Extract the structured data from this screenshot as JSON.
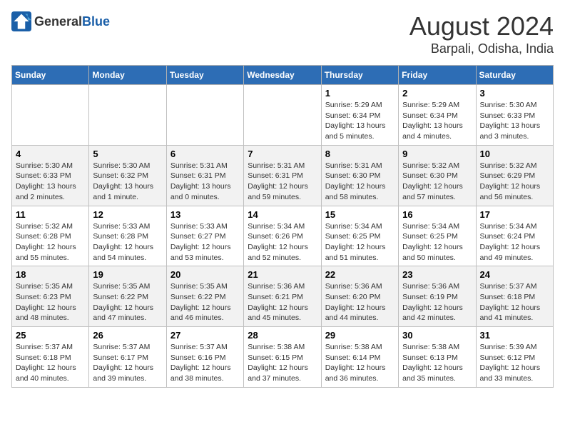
{
  "logo": {
    "general": "General",
    "blue": "Blue"
  },
  "title": "August 2024",
  "subtitle": "Barpali, Odisha, India",
  "headers": [
    "Sunday",
    "Monday",
    "Tuesday",
    "Wednesday",
    "Thursday",
    "Friday",
    "Saturday"
  ],
  "weeks": [
    [
      {
        "day": "",
        "info": ""
      },
      {
        "day": "",
        "info": ""
      },
      {
        "day": "",
        "info": ""
      },
      {
        "day": "",
        "info": ""
      },
      {
        "day": "1",
        "info": "Sunrise: 5:29 AM\nSunset: 6:34 PM\nDaylight: 13 hours\nand 5 minutes."
      },
      {
        "day": "2",
        "info": "Sunrise: 5:29 AM\nSunset: 6:34 PM\nDaylight: 13 hours\nand 4 minutes."
      },
      {
        "day": "3",
        "info": "Sunrise: 5:30 AM\nSunset: 6:33 PM\nDaylight: 13 hours\nand 3 minutes."
      }
    ],
    [
      {
        "day": "4",
        "info": "Sunrise: 5:30 AM\nSunset: 6:33 PM\nDaylight: 13 hours\nand 2 minutes."
      },
      {
        "day": "5",
        "info": "Sunrise: 5:30 AM\nSunset: 6:32 PM\nDaylight: 13 hours\nand 1 minute."
      },
      {
        "day": "6",
        "info": "Sunrise: 5:31 AM\nSunset: 6:31 PM\nDaylight: 13 hours\nand 0 minutes."
      },
      {
        "day": "7",
        "info": "Sunrise: 5:31 AM\nSunset: 6:31 PM\nDaylight: 12 hours\nand 59 minutes."
      },
      {
        "day": "8",
        "info": "Sunrise: 5:31 AM\nSunset: 6:30 PM\nDaylight: 12 hours\nand 58 minutes."
      },
      {
        "day": "9",
        "info": "Sunrise: 5:32 AM\nSunset: 6:30 PM\nDaylight: 12 hours\nand 57 minutes."
      },
      {
        "day": "10",
        "info": "Sunrise: 5:32 AM\nSunset: 6:29 PM\nDaylight: 12 hours\nand 56 minutes."
      }
    ],
    [
      {
        "day": "11",
        "info": "Sunrise: 5:32 AM\nSunset: 6:28 PM\nDaylight: 12 hours\nand 55 minutes."
      },
      {
        "day": "12",
        "info": "Sunrise: 5:33 AM\nSunset: 6:28 PM\nDaylight: 12 hours\nand 54 minutes."
      },
      {
        "day": "13",
        "info": "Sunrise: 5:33 AM\nSunset: 6:27 PM\nDaylight: 12 hours\nand 53 minutes."
      },
      {
        "day": "14",
        "info": "Sunrise: 5:34 AM\nSunset: 6:26 PM\nDaylight: 12 hours\nand 52 minutes."
      },
      {
        "day": "15",
        "info": "Sunrise: 5:34 AM\nSunset: 6:25 PM\nDaylight: 12 hours\nand 51 minutes."
      },
      {
        "day": "16",
        "info": "Sunrise: 5:34 AM\nSunset: 6:25 PM\nDaylight: 12 hours\nand 50 minutes."
      },
      {
        "day": "17",
        "info": "Sunrise: 5:34 AM\nSunset: 6:24 PM\nDaylight: 12 hours\nand 49 minutes."
      }
    ],
    [
      {
        "day": "18",
        "info": "Sunrise: 5:35 AM\nSunset: 6:23 PM\nDaylight: 12 hours\nand 48 minutes."
      },
      {
        "day": "19",
        "info": "Sunrise: 5:35 AM\nSunset: 6:22 PM\nDaylight: 12 hours\nand 47 minutes."
      },
      {
        "day": "20",
        "info": "Sunrise: 5:35 AM\nSunset: 6:22 PM\nDaylight: 12 hours\nand 46 minutes."
      },
      {
        "day": "21",
        "info": "Sunrise: 5:36 AM\nSunset: 6:21 PM\nDaylight: 12 hours\nand 45 minutes."
      },
      {
        "day": "22",
        "info": "Sunrise: 5:36 AM\nSunset: 6:20 PM\nDaylight: 12 hours\nand 44 minutes."
      },
      {
        "day": "23",
        "info": "Sunrise: 5:36 AM\nSunset: 6:19 PM\nDaylight: 12 hours\nand 42 minutes."
      },
      {
        "day": "24",
        "info": "Sunrise: 5:37 AM\nSunset: 6:18 PM\nDaylight: 12 hours\nand 41 minutes."
      }
    ],
    [
      {
        "day": "25",
        "info": "Sunrise: 5:37 AM\nSunset: 6:18 PM\nDaylight: 12 hours\nand 40 minutes."
      },
      {
        "day": "26",
        "info": "Sunrise: 5:37 AM\nSunset: 6:17 PM\nDaylight: 12 hours\nand 39 minutes."
      },
      {
        "day": "27",
        "info": "Sunrise: 5:37 AM\nSunset: 6:16 PM\nDaylight: 12 hours\nand 38 minutes."
      },
      {
        "day": "28",
        "info": "Sunrise: 5:38 AM\nSunset: 6:15 PM\nDaylight: 12 hours\nand 37 minutes."
      },
      {
        "day": "29",
        "info": "Sunrise: 5:38 AM\nSunset: 6:14 PM\nDaylight: 12 hours\nand 36 minutes."
      },
      {
        "day": "30",
        "info": "Sunrise: 5:38 AM\nSunset: 6:13 PM\nDaylight: 12 hours\nand 35 minutes."
      },
      {
        "day": "31",
        "info": "Sunrise: 5:39 AM\nSunset: 6:12 PM\nDaylight: 12 hours\nand 33 minutes."
      }
    ]
  ]
}
